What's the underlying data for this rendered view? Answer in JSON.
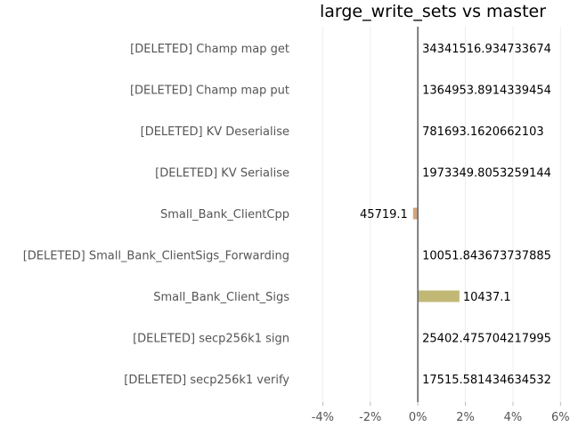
{
  "chart_data": {
    "type": "bar",
    "orientation": "horizontal",
    "title": "large_write_sets vs master",
    "xlabel": "",
    "ylabel": "",
    "xlim": [
      -4.8,
      6.1
    ],
    "xticks": [
      -4,
      -2,
      0,
      2,
      4,
      6
    ],
    "xtick_labels": [
      "-4%",
      "-2%",
      "0%",
      "2%",
      "4%",
      "6%"
    ],
    "grid": true,
    "bars": [
      {
        "label": "[DELETED] Champ map get",
        "value": 0,
        "value_label": "34341516.934733674",
        "color": ""
      },
      {
        "label": "[DELETED] Champ map put",
        "value": 0,
        "value_label": "1364953.8914339454",
        "color": ""
      },
      {
        "label": "[DELETED] KV Deserialise",
        "value": 0,
        "value_label": "781693.1620662103",
        "color": ""
      },
      {
        "label": "[DELETED] KV Serialise",
        "value": 0,
        "value_label": "1973349.8053259144",
        "color": ""
      },
      {
        "label": "Small_Bank_ClientCpp",
        "value": -0.2,
        "value_label": "45719.1",
        "color": "#d4a47c"
      },
      {
        "label": "[DELETED] Small_Bank_ClientSigs_Forwarding",
        "value": 0,
        "value_label": "10051.843673737885",
        "color": ""
      },
      {
        "label": "Small_Bank_Client_Sigs",
        "value": 1.75,
        "value_label": "10437.1",
        "color": "#c2b876"
      },
      {
        "label": "[DELETED] secp256k1 sign",
        "value": 0,
        "value_label": "25402.475704217995",
        "color": ""
      },
      {
        "label": "[DELETED] secp256k1 verify",
        "value": 0,
        "value_label": "17515.581434634532",
        "color": ""
      }
    ]
  }
}
